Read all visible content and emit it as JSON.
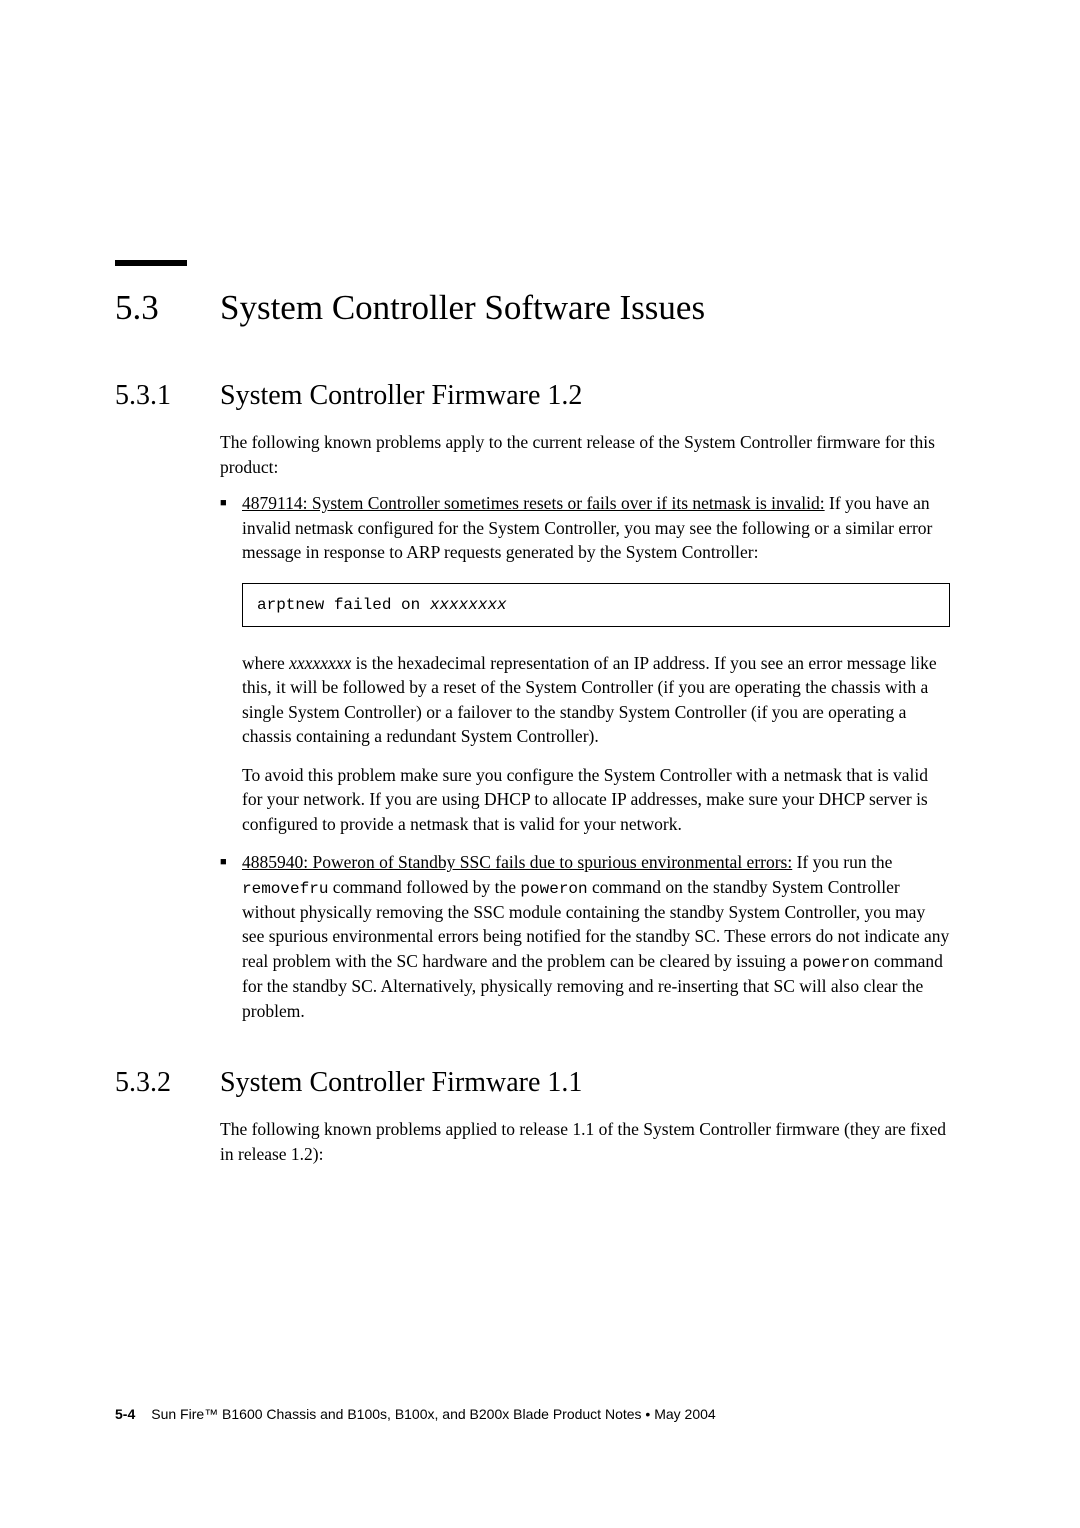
{
  "section": {
    "number": "5.3",
    "title": "System Controller Software Issues"
  },
  "sub1": {
    "number": "5.3.1",
    "title": "System Controller Firmware 1.2",
    "intro": "The following known problems apply to the current release of the System Controller firmware for this product:",
    "bullet1": {
      "lead": "4879114: System Controller sometimes resets or fails over if its netmask is invalid:",
      "rest": " If you have an invalid netmask configured for the System Controller, you may see the following or a similar error message in response to ARP requests generated by the System Controller:"
    },
    "code": {
      "text": "arptnew failed on ",
      "var": "xxxxxxxx"
    },
    "para1a": "where ",
    "para1var": "xxxxxxxx",
    "para1b": " is the hexadecimal representation of an IP address. If you see an error message like this, it will be followed by a reset of the System Controller (if you are operating the chassis with a single System Controller) or a failover to the standby System Controller (if you are operating a chassis containing a redundant System Controller).",
    "para2": "To avoid this problem make sure you configure the System Controller with a netmask that is valid for your network. If you are using DHCP to allocate IP addresses, make sure your DHCP server is configured to provide a netmask that is valid for your network.",
    "bullet2": {
      "lead": "4885940: Poweron of Standby SSC fails due to spurious environmental errors:",
      "rest1": " If you run the ",
      "cmd1": "removefru",
      "rest2": " command followed by the ",
      "cmd2": "poweron",
      "rest3": " command on the standby System Controller without physically removing the SSC module containing the standby System Controller, you may see spurious environmental errors being notified for the standby SC. These errors do not indicate any real problem with the SC hardware and the problem can be cleared by issuing a ",
      "cmd3": "poweron",
      "rest4": " command for the standby SC. Alternatively, physically removing and re-inserting that SC will also clear the problem."
    }
  },
  "sub2": {
    "number": "5.3.2",
    "title": "System Controller Firmware 1.1",
    "intro": "The following known problems applied to release 1.1 of the System Controller firmware (they are fixed in release 1.2):"
  },
  "footer": {
    "page": "5-4",
    "text": "Sun Fire™ B1600 Chassis and B100s, B100x, and B200x Blade Product Notes  •  May 2004"
  }
}
